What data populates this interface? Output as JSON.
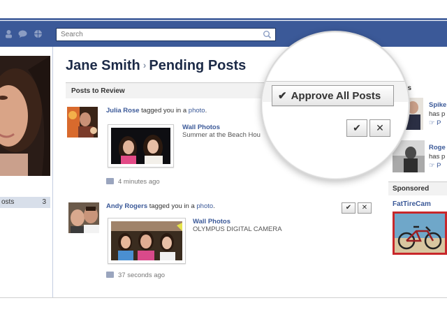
{
  "topbar": {
    "search_placeholder": "Search",
    "icons": [
      "friend-requests-icon",
      "messages-icon",
      "notifications-icon",
      "search-icon"
    ]
  },
  "sidebar": {
    "posts_label": "osts",
    "posts_count": "3"
  },
  "main": {
    "owner_name": "Jane Smith",
    "separator": "›",
    "page_name": "Pending Posts",
    "review_header": "Posts to Review",
    "approve_all_label": "Approve All Posts",
    "approve_icon": "✔",
    "reject_icon": "✕"
  },
  "posts": [
    {
      "author": "Julia Rose",
      "action": " tagged you in a ",
      "object": "photo",
      "punct": ".",
      "album_title": "Wall Photos",
      "album_caption": "Summer at the Beach Hou",
      "time": "4 minutes ago"
    },
    {
      "author": "Andy Rogers",
      "action": " tagged you in a ",
      "object": "photo",
      "punct": ".",
      "album_title": "Wall Photos",
      "album_caption": "OLYMPUS DIGITAL CAMERA",
      "time": "37 seconds ago"
    }
  ],
  "right_column": {
    "people_header": "es",
    "person1": {
      "name": "Spike",
      "line2": "has p",
      "line3": "P"
    },
    "person2": {
      "name": "Roge",
      "line2": "has p",
      "line3": "P"
    },
    "sponsored_header": "Sponsored",
    "ad_title": "FatTireCam"
  },
  "colors": {
    "brand_blue": "#3b5998",
    "link_blue": "#3b5998",
    "header_gray": "#f2f2f2"
  }
}
